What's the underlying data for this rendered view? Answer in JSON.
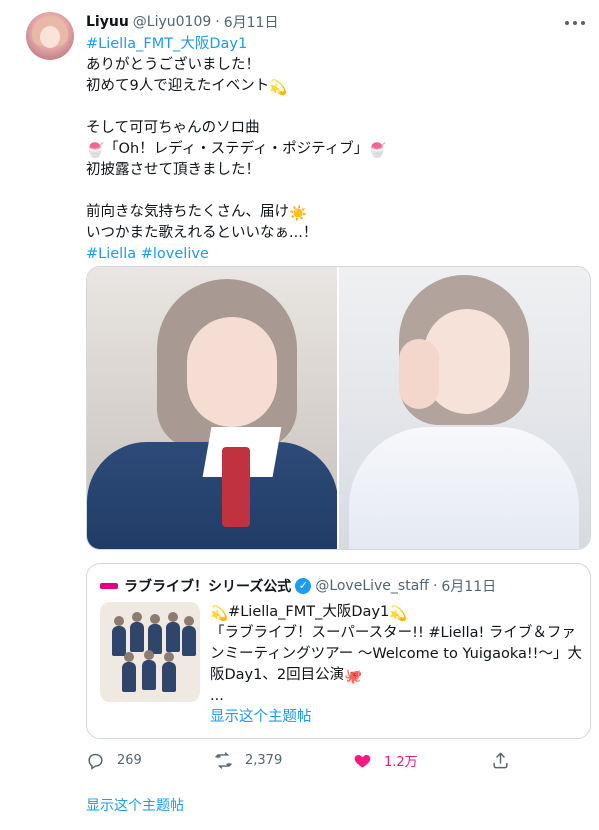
{
  "tweet": {
    "author": {
      "name": "Liyuu",
      "handle": "@Liyu0109",
      "date": "6月11日"
    },
    "hashtag_top": "#Liella_FMT_大阪Day1",
    "lines": {
      "l1": "ありがとうございました！",
      "l2": "初めて9人で迎えたイベント",
      "l3": "そして可可ちゃんのソロ曲",
      "l4": "「Oh！レディ・ステディ・ポジティブ」",
      "l5": "初披露させて頂きました！",
      "l6": "前向きな気持ちたくさん、届け",
      "l7": "いつかまた歌えれるといいなぁ...！"
    },
    "emojis": {
      "sparkle": "💫",
      "shaved_ice": "🍧",
      "sun": "☀️",
      "octopus": "🐙"
    },
    "hashtags_bottom": [
      "#Liella",
      "#lovelive"
    ],
    "media": [
      "photo-left",
      "photo-right"
    ]
  },
  "quote": {
    "name": "ラブライブ！シリーズ公式",
    "handle": "@LoveLive_staff",
    "date": "6月11日",
    "lines": {
      "l1": "#Liella_FMT_大阪Day1",
      "l2": "「ラブライブ！スーパースター!! #Liella! ライブ＆ファ",
      "l3": "ンミーティングツアー ～Welcome to Yuigaoka!!～」大",
      "l4": "阪Day1、2回目公演",
      "l5": "..."
    },
    "show_thread": "显示这个主题帖"
  },
  "actions": {
    "reply_count": "269",
    "retweet_count": "2,379",
    "like_count": "1.2万",
    "like_color": "#f91880"
  },
  "footer": {
    "show_thread": "显示这个主题帖"
  },
  "colors": {
    "link": "#1d9bf0",
    "muted": "#536471",
    "border": "#cfd9de"
  }
}
